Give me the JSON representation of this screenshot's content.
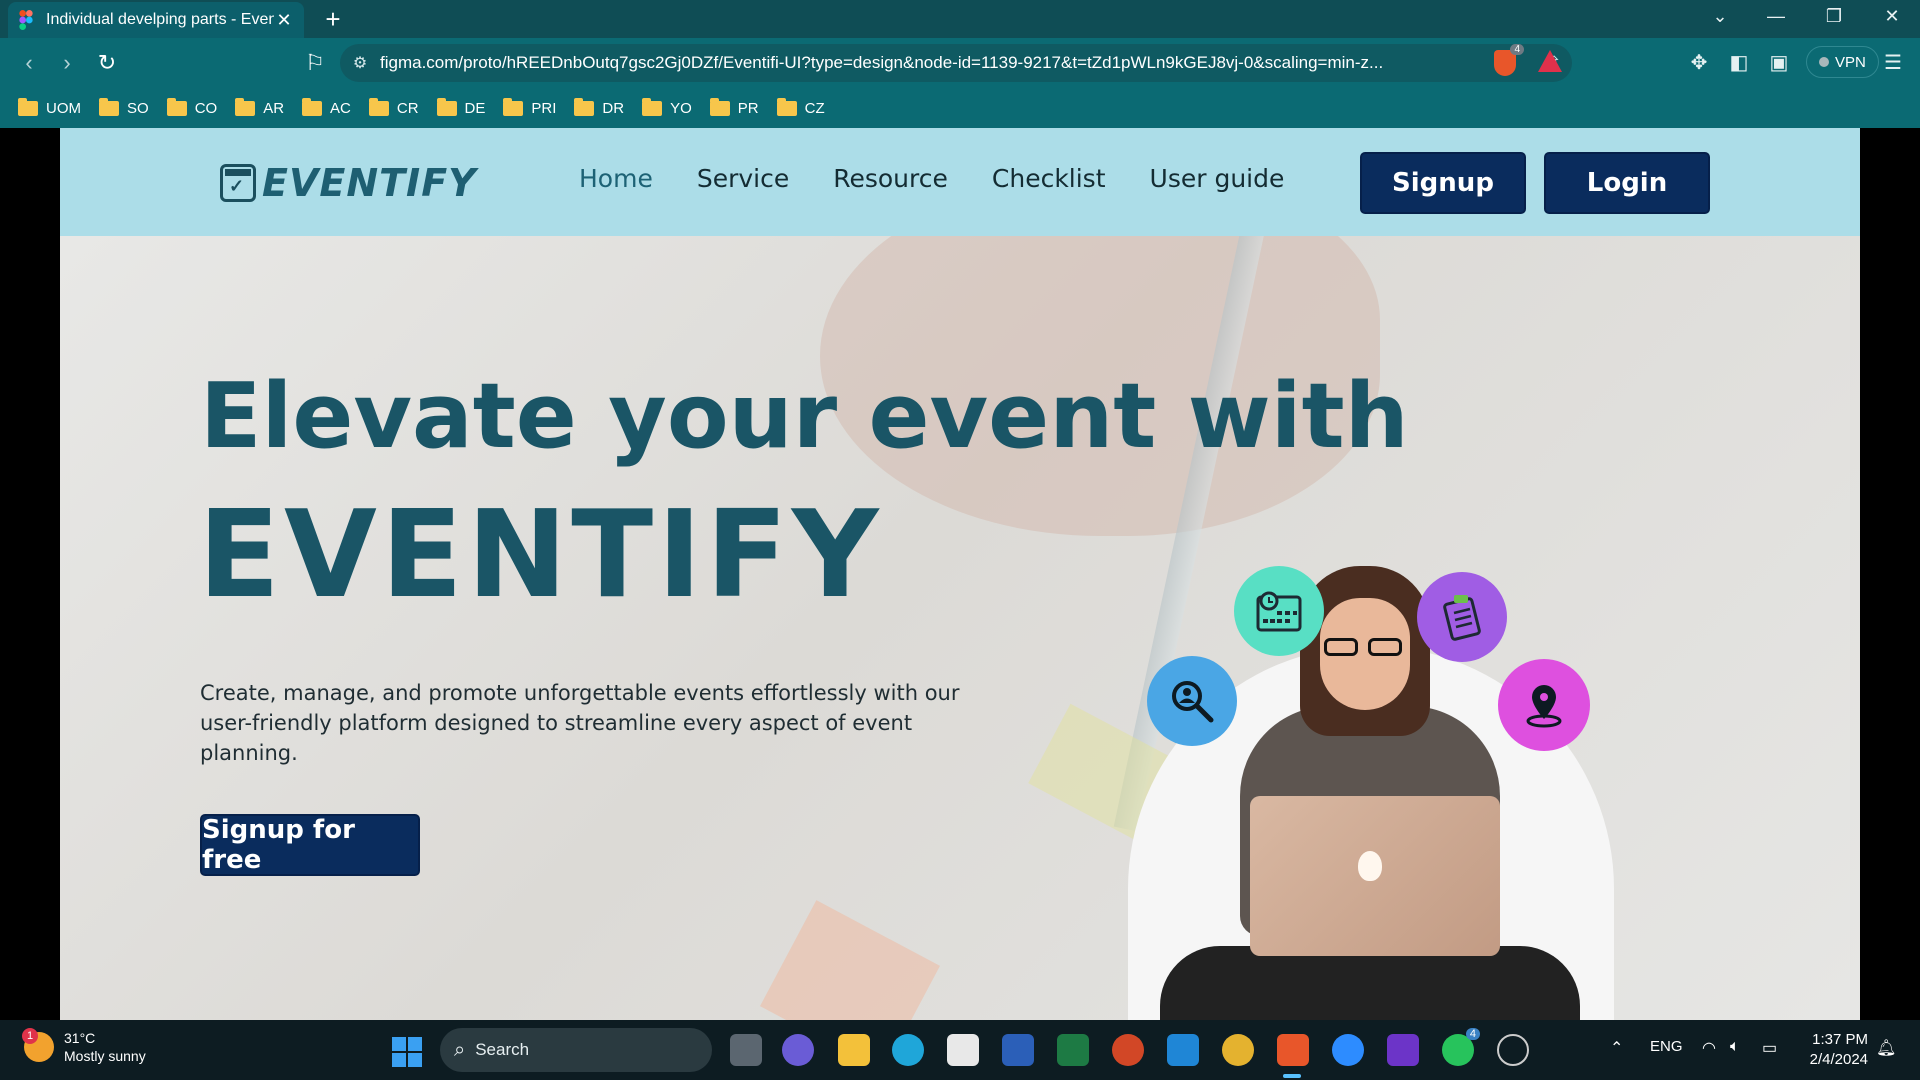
{
  "browser": {
    "tab_title": "Individual develping parts - Eventi",
    "tab_close": "✕",
    "new_tab": "+",
    "url": "figma.com/proto/hREEDnbOutq7gsc2Gj0DZf/Eventifi-UI?type=design&node-id=1139-9217&t=tZd1pWLn9kGEJ8vj-0&scaling=min-z...",
    "shield_count": "4",
    "vpn_label": "VPN",
    "bookmarks": [
      "UOM",
      "SO",
      "CO",
      "AR",
      "AC",
      "CR",
      "DE",
      "PRI",
      "DR",
      "YO",
      "PR",
      "CZ"
    ]
  },
  "site": {
    "logo_text": "EVENTIFY",
    "nav": {
      "home": "Home",
      "service": "Service",
      "resource": "Resource",
      "checklist": "Checklist",
      "user_guide": "User guide"
    },
    "signup_label": "Signup",
    "login_label": "Login"
  },
  "hero": {
    "headline_line1": "Elevate your event with",
    "headline_line2": "EVENTIFY",
    "subtitle": "Create, manage, and promote unforgettable events effortlessly with our user-friendly platform designed to streamline every aspect of event planning.",
    "cta_label": "Signup for free"
  },
  "taskbar": {
    "notification_count": "1",
    "temperature": "31°C",
    "weather": "Mostly sunny",
    "search_placeholder": "Search",
    "whatsapp_badge": "4",
    "language": "ENG",
    "time": "1:37 PM",
    "date": "2/4/2024"
  },
  "colors": {
    "nav_bg": "#acdde8",
    "primary_dark": "#0a2c5d",
    "heading_teal": "#1a5566",
    "browser_chrome": "#0b6a73"
  }
}
